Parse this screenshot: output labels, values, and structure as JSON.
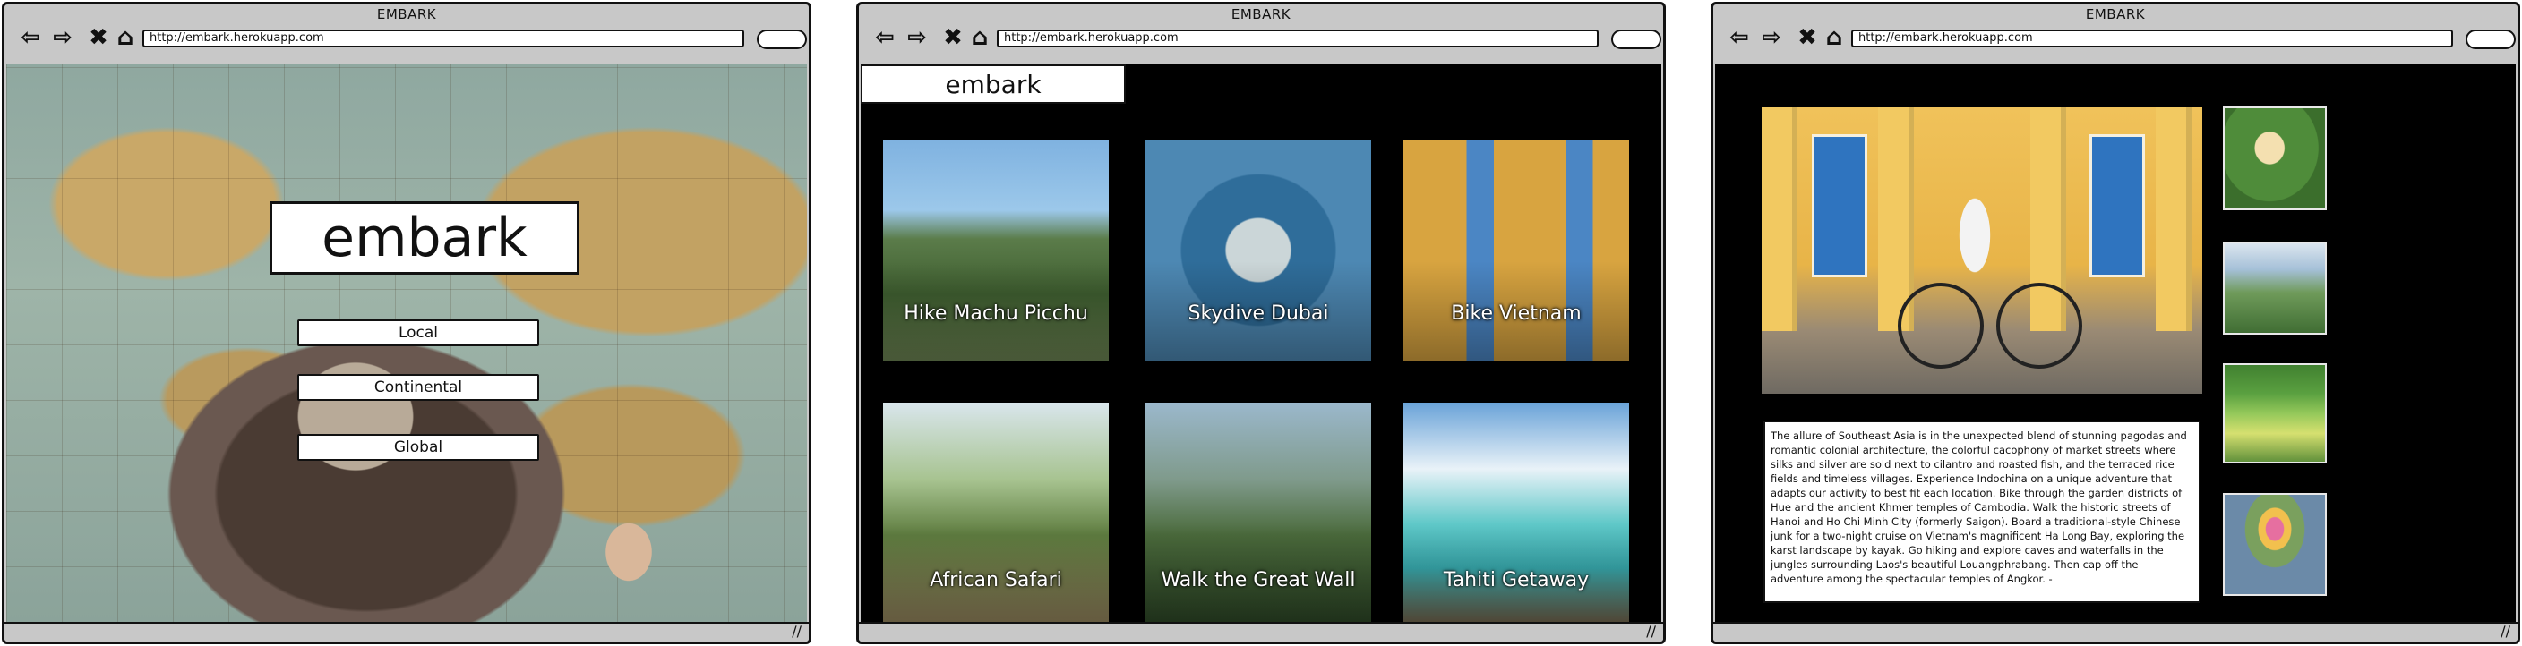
{
  "windows": [
    {
      "title": "EMBARK",
      "url": "http://embark.herokuapp.com",
      "page": {
        "brand": "embark",
        "scope_buttons": [
          "Local",
          "Continental",
          "Global"
        ]
      }
    },
    {
      "title": "EMBARK",
      "url": "http://embark.herokuapp.com",
      "page": {
        "brand": "embark",
        "experiences": [
          "Hike Machu Picchu",
          "Skydive Dubai",
          "Bike Vietnam",
          "African Safari",
          "Walk the Great Wall",
          "Tahiti Getaway"
        ]
      }
    },
    {
      "title": "EMBARK",
      "url": "http://embark.herokuapp.com",
      "page": {
        "description": "The allure of Southeast Asia is in the unexpected blend of stunning pagodas and romantic colonial architecture, the colorful cacophony of market streets where silks and silver are sold next to cilantro and roasted fish, and the terraced rice fields and timeless villages. Experience Indochina on a unique adventure that adapts our activity to best fit each location. Bike through the garden districts of Hue and the ancient Khmer temples of Cambodia. Walk the historic streets of Hanoi and Ho Chi Minh City (formerly Saigon). Board a traditional-style Chinese junk for a two-night cruise on Vietnam's magnificent Ha Long Bay, exploring the karst landscape by kayak. Go hiking and explore caves and waterfalls in the jungles surrounding Laos's beautiful Louangphrabang. Then cap off the adventure among the spectacular temples of Angkor. -"
      }
    }
  ],
  "icons": {
    "back": "arrow-left",
    "forward": "arrow-right",
    "stop": "x",
    "home": "house",
    "resize": "resize-grip"
  },
  "colors": {
    "chrome": "#c8c8c8",
    "viewport": "#000000",
    "door_blue": "#2f74bf"
  }
}
